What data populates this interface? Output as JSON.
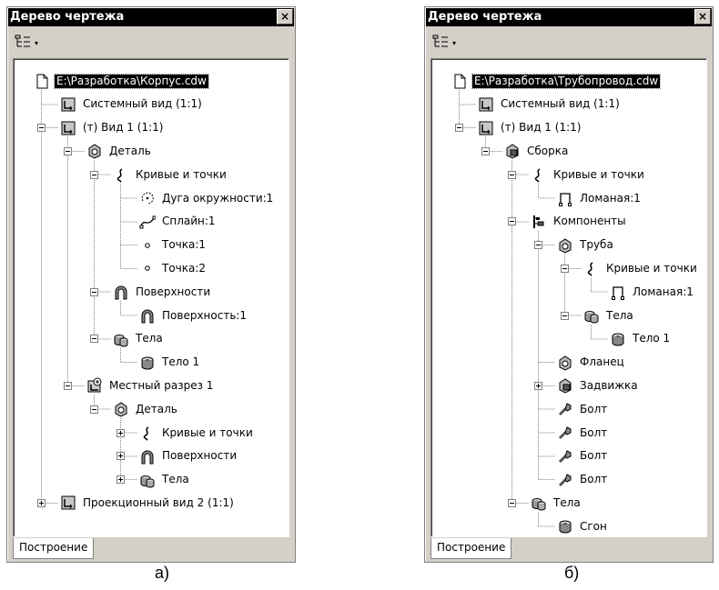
{
  "panels": [
    {
      "title": "Дерево чертежа",
      "close_glyph": "×",
      "toolbar": {
        "icon": "tree-view-icon",
        "arrow": "▾"
      },
      "tab_label": "Построение",
      "caption": "а)",
      "items": [
        {
          "label": "E:\\Разработка\\Корпус.cdw",
          "icon": "document-icon",
          "level": 0,
          "selected": true,
          "exp": null
        },
        {
          "label": "Системный вид (1:1)",
          "icon": "view-icon",
          "level": 1,
          "exp": null
        },
        {
          "label": "(т) Вид 1 (1:1)",
          "icon": "view-icon",
          "level": 1,
          "exp": "minus"
        },
        {
          "label": "Деталь",
          "icon": "part-icon",
          "level": 2,
          "exp": "minus"
        },
        {
          "label": "Кривые и точки",
          "icon": "curves-icon",
          "level": 3,
          "exp": "minus"
        },
        {
          "label": "Дуга окружности:1",
          "icon": "arc-icon",
          "level": 4,
          "exp": null
        },
        {
          "label": "Сплайн:1",
          "icon": "spline-icon",
          "level": 4,
          "exp": null
        },
        {
          "label": "Точка:1",
          "icon": "point-icon",
          "level": 4,
          "exp": null
        },
        {
          "label": "Точка:2",
          "icon": "point-icon",
          "level": 4,
          "exp": null
        },
        {
          "label": "Поверхности",
          "icon": "surfaces-icon",
          "level": 3,
          "exp": "minus"
        },
        {
          "label": "Поверхность:1",
          "icon": "surfaces-icon",
          "level": 4,
          "exp": null
        },
        {
          "label": "Тела",
          "icon": "bodies-icon",
          "level": 3,
          "exp": "minus"
        },
        {
          "label": "Тело 1",
          "icon": "body-icon",
          "level": 4,
          "exp": null
        },
        {
          "label": "Местный разрез 1",
          "icon": "local-section-icon",
          "level": 2,
          "exp": "minus"
        },
        {
          "label": "Деталь",
          "icon": "part-icon",
          "level": 3,
          "exp": "minus"
        },
        {
          "label": "Кривые и точки",
          "icon": "curves-icon",
          "level": 4,
          "exp": "plus"
        },
        {
          "label": "Поверхности",
          "icon": "surfaces-icon",
          "level": 4,
          "exp": "plus"
        },
        {
          "label": "Тела",
          "icon": "bodies-icon",
          "level": 4,
          "exp": "plus"
        },
        {
          "label": "Проекционный вид 2 (1:1)",
          "icon": "view-icon",
          "level": 1,
          "exp": "plus"
        }
      ]
    },
    {
      "title": "Дерево чертежа",
      "close_glyph": "×",
      "toolbar": {
        "icon": "tree-view-icon",
        "arrow": "▾"
      },
      "tab_label": "Построение",
      "caption": "б)",
      "items": [
        {
          "label": "E:\\Разработка\\Трубопровод.cdw",
          "icon": "document-icon",
          "level": 0,
          "selected": true,
          "exp": null
        },
        {
          "label": "Системный вид (1:1)",
          "icon": "view-icon",
          "level": 1,
          "exp": null
        },
        {
          "label": "(т) Вид 1 (1:1)",
          "icon": "view-icon",
          "level": 1,
          "exp": "minus"
        },
        {
          "label": "Сборка",
          "icon": "assembly-icon",
          "level": 2,
          "exp": "minus"
        },
        {
          "label": "Кривые и точки",
          "icon": "curves-icon",
          "level": 3,
          "exp": "minus"
        },
        {
          "label": "Ломаная:1",
          "icon": "polyline-icon",
          "level": 4,
          "exp": null
        },
        {
          "label": "Компоненты",
          "icon": "components-icon",
          "level": 3,
          "exp": "minus"
        },
        {
          "label": "Труба",
          "icon": "part-icon",
          "level": 4,
          "exp": "minus"
        },
        {
          "label": "Кривые и точки",
          "icon": "curves-icon",
          "level": 5,
          "exp": "minus"
        },
        {
          "label": "Ломаная:1",
          "icon": "polyline-icon",
          "level": 6,
          "exp": null
        },
        {
          "label": "Тела",
          "icon": "bodies-icon",
          "level": 5,
          "exp": "minus"
        },
        {
          "label": "Тело 1",
          "icon": "body-icon",
          "level": 6,
          "exp": null
        },
        {
          "label": "Фланец",
          "icon": "part-icon",
          "level": 4,
          "exp": null
        },
        {
          "label": "Задвижка",
          "icon": "assembly-icon",
          "level": 4,
          "exp": "plus"
        },
        {
          "label": "Болт",
          "icon": "bolt-icon",
          "level": 4,
          "exp": null
        },
        {
          "label": "Болт",
          "icon": "bolt-icon",
          "level": 4,
          "exp": null
        },
        {
          "label": "Болт",
          "icon": "bolt-icon",
          "level": 4,
          "exp": null
        },
        {
          "label": "Болт",
          "icon": "bolt-icon",
          "level": 4,
          "exp": null
        },
        {
          "label": "Тела",
          "icon": "bodies-icon",
          "level": 3,
          "exp": "minus"
        },
        {
          "label": "Сгон",
          "icon": "body-icon",
          "level": 4,
          "exp": null
        }
      ]
    }
  ]
}
